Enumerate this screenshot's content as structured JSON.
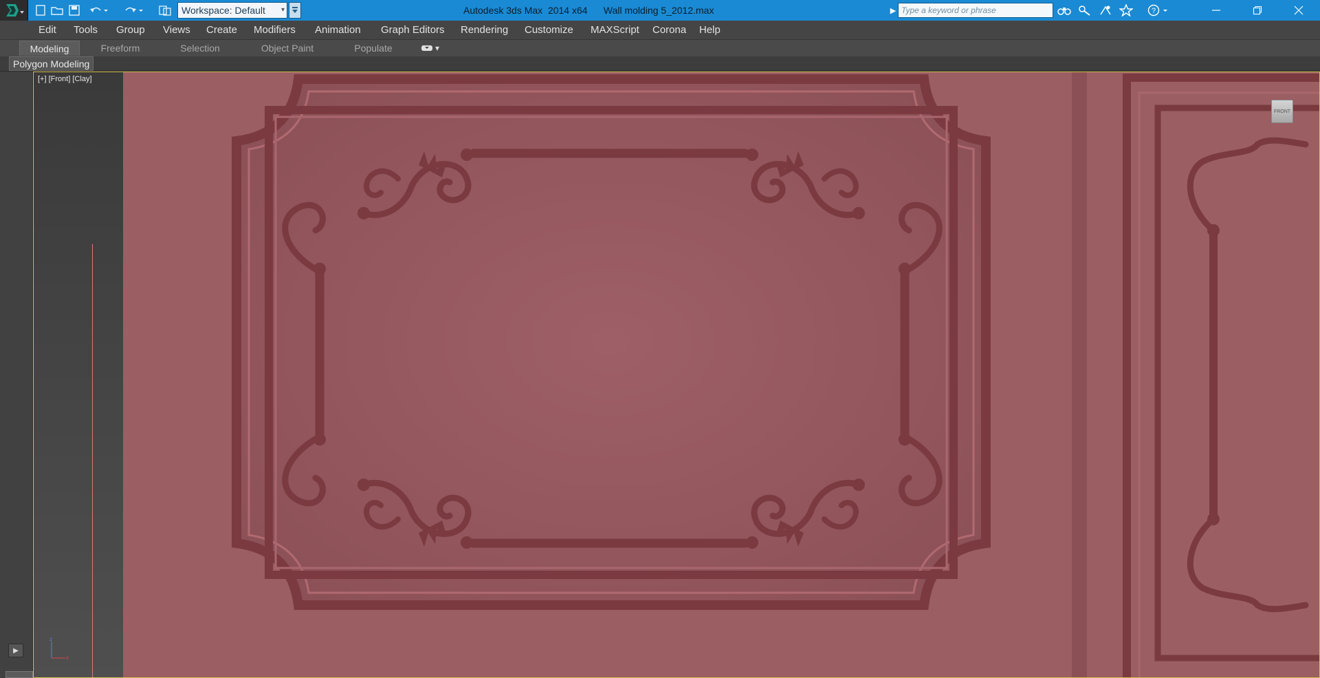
{
  "titlebar": {
    "workspace_label": "Workspace: Default",
    "app_title": "Autodesk 3ds Max  2014 x64      Wall molding 5_2012.max",
    "search_placeholder": "Type a keyword or phrase"
  },
  "menu": [
    "Edit",
    "Tools",
    "Group",
    "Views",
    "Create",
    "Modifiers",
    "Animation",
    "Graph Editors",
    "Rendering",
    "Customize",
    "MAXScript",
    "Corona",
    "Help"
  ],
  "ribbon": {
    "tabs": [
      "Modeling",
      "Freeform",
      "Selection",
      "Object Paint",
      "Populate"
    ],
    "active_tab": "Modeling",
    "panel_label": "Polygon Modeling"
  },
  "viewport": {
    "label": "[+] [Front] [Clay]",
    "viewcube_label": "FRONT",
    "axis_z": "z",
    "axis_x": "x"
  },
  "colors": {
    "titlebar": "#1a8ad4",
    "molding": "#9b5e63",
    "molding_dark": "#7a3a3f",
    "viewport_border": "#d7c44a"
  }
}
